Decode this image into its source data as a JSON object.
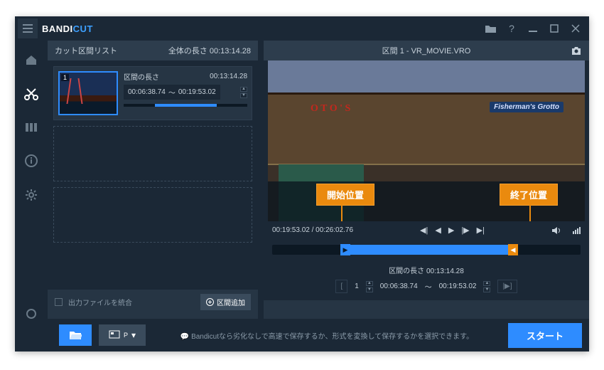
{
  "app": {
    "name_a": "BANDI",
    "name_b": "CUT"
  },
  "left": {
    "title": "カット区間リスト",
    "total_label": "全体の長さ",
    "total_time": "00:13:14.28",
    "seg_len_label": "区間の長さ",
    "seg_len_time": "00:13:14.28",
    "seg_start": "00:06:38.74",
    "seg_end": "00:19:53.02",
    "tilde": "～",
    "idx": "1",
    "merge_label": "出力ファイルを統合",
    "add_label": "区間追加"
  },
  "video": {
    "title": "区間 1 - VR_MOVIE.VRO",
    "sign_red": "O T O ' S",
    "sign_blue": "Fisherman's Grotto",
    "annot_start": "開始位置",
    "annot_end": "終了位置"
  },
  "play": {
    "pos": "00:19:53.02",
    "dur": "00:26:02.76",
    "sep": "/"
  },
  "edit": {
    "seg_len_label": "区間の長さ",
    "seg_len_time": "00:13:14.28",
    "t1": "00:06:38.74",
    "t2": "00:19:53.02",
    "tilde": "～",
    "one": "1"
  },
  "bottom": {
    "hint": "Bandicutなら劣化なしで高速で保存するか、形式を変換して保存するかを選択できます。",
    "start": "スタート"
  }
}
